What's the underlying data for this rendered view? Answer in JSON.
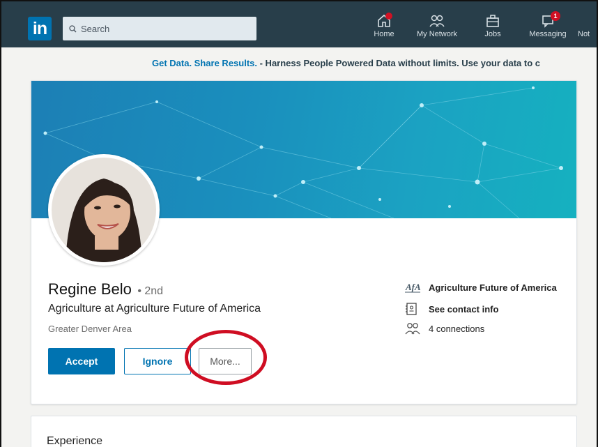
{
  "nav": {
    "logo_text": "in",
    "search": {
      "placeholder": "Search"
    },
    "items": [
      {
        "label": "Home",
        "icon": "home-icon",
        "badge": ""
      },
      {
        "label": "My Network",
        "icon": "network-icon",
        "badge": ""
      },
      {
        "label": "Jobs",
        "icon": "jobs-icon",
        "badge": ""
      },
      {
        "label": "Messaging",
        "icon": "messaging-icon",
        "badge": "1"
      },
      {
        "label": "Not",
        "icon": "notifications-icon",
        "badge": ""
      }
    ]
  },
  "ad": {
    "link_text": "Get Data. Share Results.",
    "body_text": " - Harness People Powered Data without limits. Use your data to c"
  },
  "profile": {
    "name": "Regine Belo",
    "degree": "• 2nd",
    "headline": "Agriculture at Agriculture Future of America",
    "location": "Greater Denver Area",
    "buttons": {
      "accept": "Accept",
      "ignore": "Ignore",
      "more": "More..."
    },
    "side": {
      "company": "Agriculture Future of America",
      "company_logo_text": "AfA",
      "contact": "See contact info",
      "connections": "4 connections"
    }
  },
  "experience": {
    "title": "Experience"
  },
  "colors": {
    "nav_bg": "#283e4a",
    "brand_blue": "#0073b1",
    "highlight_red": "#cf0d22",
    "notification_red": "#d11124"
  }
}
